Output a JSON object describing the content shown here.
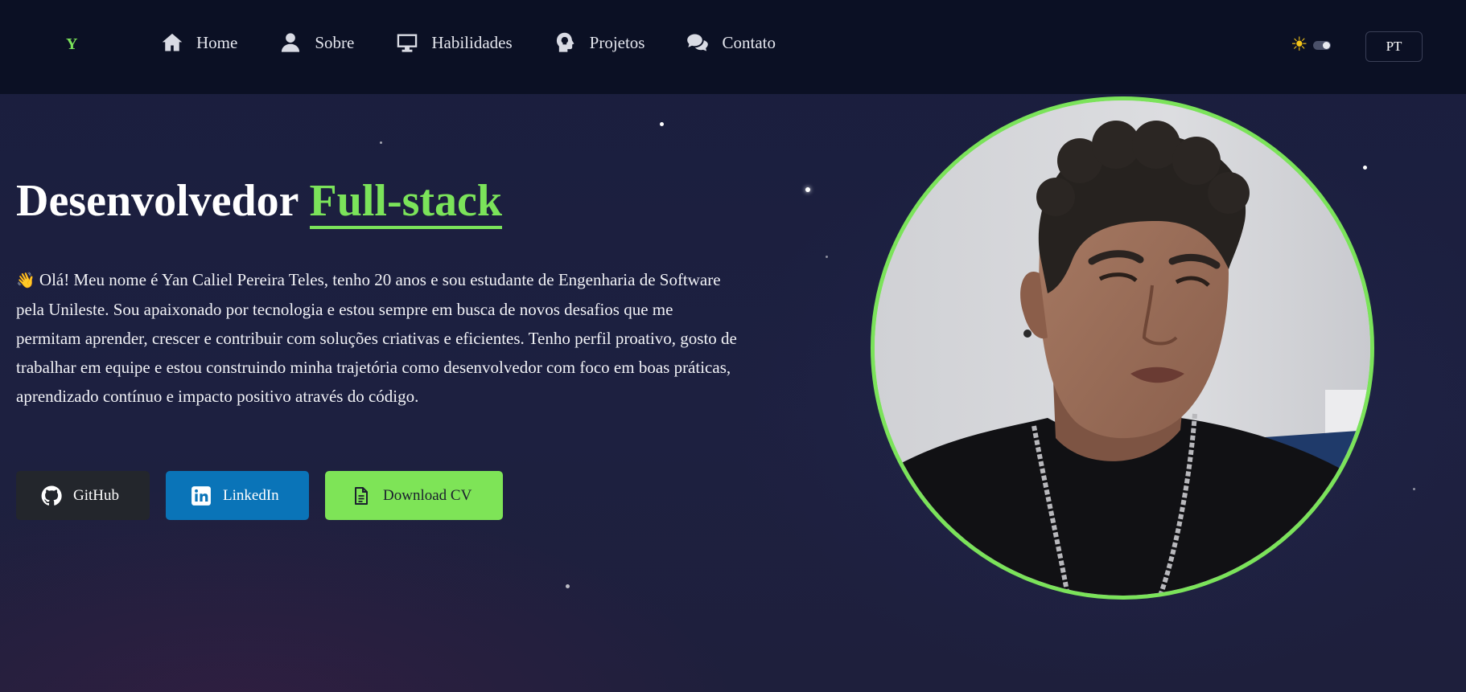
{
  "nav": {
    "logo": "Y",
    "items": [
      {
        "label": "Home",
        "icon": "home-icon"
      },
      {
        "label": "Sobre",
        "icon": "user-icon"
      },
      {
        "label": "Habilidades",
        "icon": "monitor-icon"
      },
      {
        "label": "Projetos",
        "icon": "lightbulb-head-icon"
      },
      {
        "label": "Contato",
        "icon": "chat-icon"
      }
    ],
    "theme_icon": "sun-icon",
    "language": "PT"
  },
  "hero": {
    "title_main": "Desenvolvedor",
    "title_accent": "Full-stack",
    "wave_emoji": "👋",
    "intro": "Olá! Meu nome é Yan Caliel Pereira Teles, tenho 20 anos e sou estudante de Engenharia de Software pela Unileste. Sou apaixonado por tecnologia e estou sempre em busca de novos desafios que me permitam aprender, crescer e contribuir com soluções criativas e eficientes. Tenho perfil proativo, gosto de trabalhar em equipe e estou construindo minha trajetória como desenvolvedor com foco em boas práticas, aprendizado contínuo e impacto positivo através do código."
  },
  "buttons": {
    "github": "GitHub",
    "linkedin": "LinkedIn",
    "cv": "Download CV"
  },
  "colors": {
    "accent": "#7be35a",
    "navbar": "#0b1024",
    "linkedin": "#0a74b8",
    "github": "#23262c"
  }
}
